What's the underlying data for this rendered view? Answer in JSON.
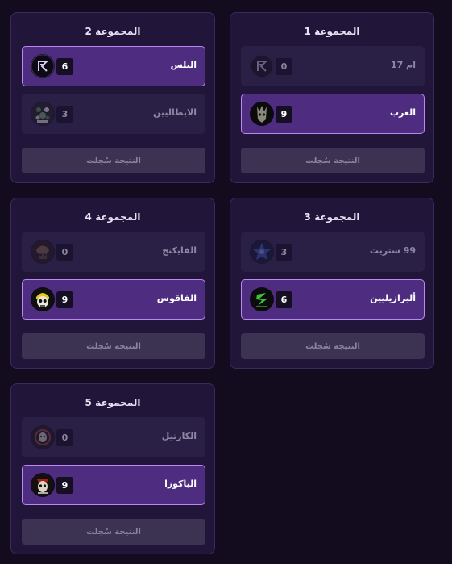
{
  "groups": [
    {
      "title": "المجموعة 1",
      "teams": [
        {
          "name": "ام 17",
          "score": "0",
          "winner": false,
          "logo": "rh-logo-icon"
        },
        {
          "name": "الغرب",
          "score": "9",
          "winner": true,
          "logo": "skull-logo-icon"
        }
      ],
      "button": "النتيجة سُجلت"
    },
    {
      "title": "المجموعة 2",
      "teams": [
        {
          "name": "البلس",
          "score": "6",
          "winner": true,
          "logo": "rh-logo-icon"
        },
        {
          "name": "الايطاليين",
          "score": "3",
          "winner": false,
          "logo": "italian-logo-icon"
        }
      ],
      "button": "النتيجة سُجلت"
    },
    {
      "title": "المجموعة 3",
      "teams": [
        {
          "name": "99 ستريت",
          "score": "3",
          "winner": false,
          "logo": "blue-logo-icon"
        },
        {
          "name": "ألبرازيليين",
          "score": "6",
          "winner": true,
          "logo": "green-logo-icon"
        }
      ],
      "button": "النتيجة سُجلت"
    },
    {
      "title": "المجموعة 4",
      "teams": [
        {
          "name": "الفايكنج",
          "score": "0",
          "winner": false,
          "logo": "viking-logo-icon"
        },
        {
          "name": "الفاقوس",
          "score": "9",
          "winner": true,
          "logo": "yellow-skull-logo-icon"
        }
      ],
      "button": "النتيجة سُجلت"
    },
    {
      "title": "المجموعة 5",
      "teams": [
        {
          "name": "الكارتيل",
          "score": "0",
          "winner": false,
          "logo": "cartel-logo-icon"
        },
        {
          "name": "الياكوزا",
          "score": "9",
          "winner": true,
          "logo": "yakuza-logo-icon"
        }
      ],
      "button": "النتيجة سُجلت"
    }
  ],
  "colors": {
    "background": "#130c1f",
    "card": "#21163a",
    "winner_row": "#4e2d80",
    "winner_border": "#b88af0"
  }
}
